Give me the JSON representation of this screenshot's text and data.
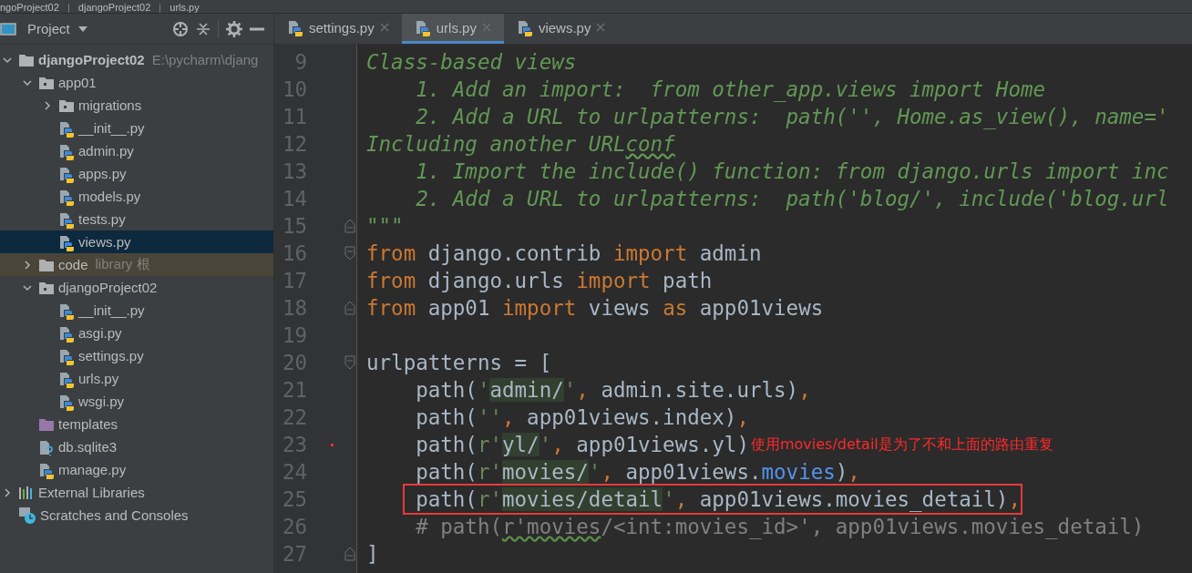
{
  "breadcrumb": [
    "ngoProject02",
    "djangoProject02",
    "urls.py"
  ],
  "project_panel": {
    "title": "Project",
    "tree": [
      {
        "label": "djangoProject02",
        "hint": "E:\\pycharm\\djang",
        "kind": "root",
        "expanded": true,
        "selected": false,
        "children": [
          {
            "label": "app01",
            "kind": "module",
            "expanded": true,
            "selected": false,
            "children": [
              {
                "label": "migrations",
                "kind": "module",
                "expanded": false,
                "selected": false
              },
              {
                "label": "__init__.py",
                "kind": "python",
                "selected": false
              },
              {
                "label": "admin.py",
                "kind": "python",
                "selected": false
              },
              {
                "label": "apps.py",
                "kind": "python",
                "selected": false
              },
              {
                "label": "models.py",
                "kind": "python",
                "selected": false
              },
              {
                "label": "tests.py",
                "kind": "python",
                "selected": false
              },
              {
                "label": "views.py",
                "kind": "python",
                "selected": true
              }
            ]
          },
          {
            "label": "code",
            "hint": "library 根",
            "kind": "library",
            "expanded": false,
            "selected": false
          },
          {
            "label": "djangoProject02",
            "kind": "module",
            "expanded": true,
            "selected": false,
            "children": [
              {
                "label": "__init__.py",
                "kind": "python",
                "selected": false
              },
              {
                "label": "asgi.py",
                "kind": "python",
                "selected": false
              },
              {
                "label": "settings.py",
                "kind": "python",
                "selected": false
              },
              {
                "label": "urls.py",
                "kind": "python",
                "selected": false
              },
              {
                "label": "wsgi.py",
                "kind": "python",
                "selected": false
              }
            ]
          },
          {
            "label": "templates",
            "kind": "templates",
            "selected": false
          },
          {
            "label": "db.sqlite3",
            "kind": "unknown",
            "selected": false
          },
          {
            "label": "manage.py",
            "kind": "python",
            "selected": false
          }
        ]
      },
      {
        "label": "External Libraries",
        "kind": "libraries",
        "expanded": false,
        "selected": false
      },
      {
        "label": "Scratches and Consoles",
        "kind": "scratches",
        "selected": false
      }
    ]
  },
  "tabs": [
    {
      "label": "settings.py",
      "selected": false
    },
    {
      "label": "urls.py",
      "selected": true
    },
    {
      "label": "views.py",
      "selected": false
    }
  ],
  "editor": {
    "lines": [
      {
        "number": "9",
        "boxed": false,
        "marked": false,
        "tokens": [
          {
            "kind": "doc",
            "text": "Class-based views"
          }
        ]
      },
      {
        "number": "10",
        "boxed": false,
        "marked": false,
        "tokens": [
          {
            "kind": "doc",
            "text": "    1. Add an import:  from other_app.views import Home"
          }
        ]
      },
      {
        "number": "11",
        "boxed": false,
        "marked": false,
        "tokens": [
          {
            "kind": "doc",
            "text": "    2. Add a URL to urlpatterns:  path('', Home.as_view(), name='"
          }
        ]
      },
      {
        "number": "12",
        "boxed": false,
        "marked": false,
        "tokens": [
          {
            "kind": "doc",
            "text": "Including another URL"
          },
          {
            "kind": "doc-typo",
            "text": "conf"
          }
        ]
      },
      {
        "number": "13",
        "boxed": false,
        "marked": false,
        "tokens": [
          {
            "kind": "doc",
            "text": "    1. Import the include() function: from django.urls import inc"
          }
        ]
      },
      {
        "number": "14",
        "boxed": false,
        "marked": false,
        "tokens": [
          {
            "kind": "doc",
            "text": "    2. Add a URL to urlpatterns:  path('blog/', include('blog.url"
          }
        ]
      },
      {
        "number": "15",
        "boxed": false,
        "marked": false,
        "fold": {
          "kind": "end"
        },
        "tokens": [
          {
            "kind": "doc",
            "text": "\"\"\""
          }
        ]
      },
      {
        "number": "16",
        "boxed": false,
        "marked": false,
        "fold": {
          "kind": "start"
        },
        "tokens": [
          {
            "kind": "kw",
            "text": "from"
          },
          {
            "kind": "plain",
            "text": " django.contrib "
          },
          {
            "kind": "kw",
            "text": "import"
          },
          {
            "kind": "plain",
            "text": " admin"
          }
        ]
      },
      {
        "number": "17",
        "boxed": false,
        "marked": false,
        "tokens": [
          {
            "kind": "kw",
            "text": "from"
          },
          {
            "kind": "plain",
            "text": " django.urls "
          },
          {
            "kind": "kw",
            "text": "import"
          },
          {
            "kind": "plain",
            "text": " path"
          }
        ]
      },
      {
        "number": "18",
        "boxed": false,
        "marked": false,
        "fold": {
          "kind": "end"
        },
        "tokens": [
          {
            "kind": "kw",
            "text": "from"
          },
          {
            "kind": "plain",
            "text": " app01 "
          },
          {
            "kind": "kw",
            "text": "import"
          },
          {
            "kind": "plain",
            "text": " views "
          },
          {
            "kind": "kw",
            "text": "as"
          },
          {
            "kind": "plain",
            "text": " app01views"
          }
        ]
      },
      {
        "number": "19",
        "boxed": false,
        "marked": false
      },
      {
        "number": "20",
        "boxed": false,
        "marked": false,
        "fold": {
          "kind": "start"
        },
        "tokens": [
          {
            "kind": "plain",
            "text": "urlpatterns = ["
          }
        ]
      },
      {
        "number": "21",
        "boxed": false,
        "marked": false,
        "tokens": [
          {
            "kind": "plain",
            "text": "    path("
          },
          {
            "kind": "quote",
            "text": "'"
          },
          {
            "kind": "url",
            "text": "admin/"
          },
          {
            "kind": "quote",
            "text": "'"
          },
          {
            "kind": "punct",
            "text": ", "
          },
          {
            "kind": "plain",
            "text": "admin.site.urls)"
          },
          {
            "kind": "punct",
            "text": ","
          }
        ]
      },
      {
        "number": "22",
        "boxed": false,
        "marked": false,
        "tokens": [
          {
            "kind": "plain",
            "text": "    path("
          },
          {
            "kind": "quote",
            "text": "''"
          },
          {
            "kind": "punct",
            "text": ", "
          },
          {
            "kind": "plain",
            "text": "app01views.index)"
          },
          {
            "kind": "punct",
            "text": ","
          }
        ]
      },
      {
        "number": "23",
        "boxed": false,
        "marked": true,
        "note": "使用movies/detail是为了不和上面的路由重复",
        "tokens": [
          {
            "kind": "plain",
            "text": "    path("
          },
          {
            "kind": "quote",
            "text": "r'"
          },
          {
            "kind": "url",
            "text": "yl/"
          },
          {
            "kind": "quote",
            "text": "'"
          },
          {
            "kind": "punct",
            "text": ", "
          },
          {
            "kind": "plain",
            "text": "app01views.yl)"
          }
        ]
      },
      {
        "number": "24",
        "boxed": false,
        "marked": false,
        "tokens": [
          {
            "kind": "plain",
            "text": "    path("
          },
          {
            "kind": "quote",
            "text": "r'"
          },
          {
            "kind": "url",
            "text": "movies/"
          },
          {
            "kind": "quote",
            "text": "'"
          },
          {
            "kind": "punct",
            "text": ", "
          },
          {
            "kind": "plain",
            "text": "app01views."
          },
          {
            "kind": "ref",
            "text": "movies"
          },
          {
            "kind": "plain",
            "text": ")"
          },
          {
            "kind": "punct",
            "text": ","
          }
        ]
      },
      {
        "number": "25",
        "boxed": true,
        "marked": false,
        "tokens": [
          {
            "kind": "plain",
            "text": "    path("
          },
          {
            "kind": "quote",
            "text": "r'"
          },
          {
            "kind": "url",
            "text": "movies/detail"
          },
          {
            "kind": "quote",
            "text": "'"
          },
          {
            "kind": "punct",
            "text": ", "
          },
          {
            "kind": "plain",
            "text": "app01views.movies_detail)"
          },
          {
            "kind": "punct",
            "text": ","
          }
        ]
      },
      {
        "number": "26",
        "boxed": false,
        "marked": false,
        "tokens": [
          {
            "kind": "comment",
            "text": "    # path("
          },
          {
            "kind": "comment-typo",
            "text": "r'movies"
          },
          {
            "kind": "comment",
            "text": "/<int:movies_id>', app01views.movies_detail)"
          }
        ]
      },
      {
        "number": "27",
        "boxed": false,
        "marked": false,
        "fold": {
          "kind": "end"
        },
        "tokens": [
          {
            "kind": "plain",
            "text": "]"
          }
        ]
      }
    ]
  }
}
